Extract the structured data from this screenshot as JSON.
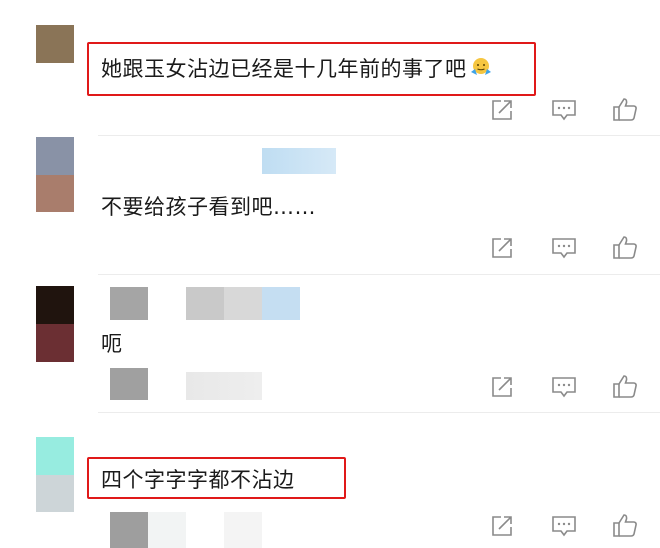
{
  "comments": [
    {
      "text": "她跟玉女沾边已经是十几年前的事了吧",
      "emoji": "shrug-emoji"
    },
    {
      "text": "不要给孩子看到吧……"
    },
    {
      "text": "呃"
    },
    {
      "text": "四个字字字都不沾边"
    }
  ],
  "colors": {
    "highlight_border": "#e01919",
    "icon_gray": "#8a8a8a",
    "divider": "#ececec"
  },
  "icons": [
    "share-icon",
    "reply-icon",
    "like-icon"
  ]
}
